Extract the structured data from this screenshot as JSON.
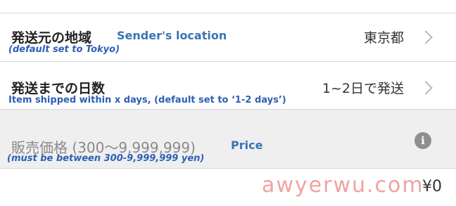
{
  "origin_row": {
    "label": "発送元の地域",
    "annotation": "Sender's location",
    "annotation_sub": "(default set to Tokyo)",
    "value": "東京都",
    "chevron_icon": "chevron-right-icon"
  },
  "days_row": {
    "label": "発送までの日数",
    "annotation_sub": "Item shipped within x days, (default set to ‘1-2 days’)",
    "value": "1~2日で発送",
    "chevron_icon": "chevron-right-icon"
  },
  "price_row": {
    "placeholder": "販売価格 (300〜9,999,999)",
    "annotation": "Price",
    "annotation_sub": "(must be between 300-9,999,999 yen)",
    "info_icon": "i"
  },
  "fee_row": {
    "value": "¥0"
  },
  "watermark": "awyerwu.com",
  "colors": {
    "annotation_blue": "#3a73b4",
    "disabled_bg": "#efeff0",
    "watermark": "#f1a2a2"
  }
}
